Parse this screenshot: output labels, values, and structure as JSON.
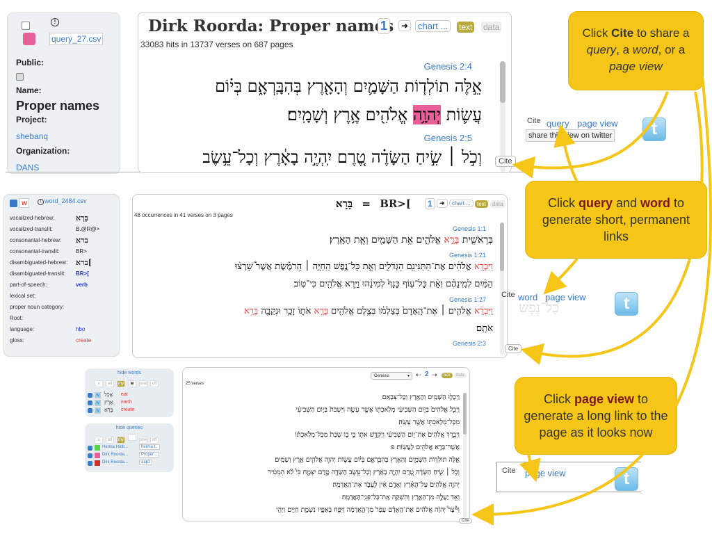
{
  "p1": {
    "csv": "query_27.csv",
    "public_label": "Public:",
    "name_label": "Name:",
    "name_value": "Proper names",
    "project_label": "Project:",
    "project_value": "shebanq",
    "org_label": "Organization:",
    "org_value": "DANS",
    "title": "Dirk Roorda: Proper names",
    "page_num": "1",
    "arrow": "➜",
    "chart_btn": "chart ...",
    "text_btn": "text",
    "data_btn": "data",
    "hits": "33083 hits in 13737 verses on 687 pages",
    "ref1": "Genesis 2:4",
    "line1": "אֵ֣לֶּה תוֹלְד֧וֹת הַשָּׁמַ֛יִם וְהָאָ֖רֶץ בְּהִבָּֽרְאָ֑ם בְּי֗וֹם",
    "line2a": "עֲשׂ֛וֹת ",
    "line2b": "יְהוָ֥ה",
    "line2c": " אֱלֹהִ֖ים אֶ֥רֶץ וְשָׁמָֽיִם׃",
    "ref2": "Genesis 2:5",
    "line3": "וְכֹ֣ל ׀ שִׂ֣יחַ הַשָּׂדֶ֗ה טֶ֚רֶם יִֽהְיֶ֣ה בָאָ֔רֶץ וְכָל־עֵ֥שֶׂב",
    "cite": "Cite",
    "cite_query": "query",
    "cite_page": "page view",
    "tooltip": "share this view on twitter"
  },
  "p2": {
    "csv": "word_2484.csv",
    "features": [
      {
        "k": "vocalized-hebrew:",
        "v": "בָּרָא"
      },
      {
        "k": "vocalized-translit:",
        "v": "B.@R@>"
      },
      {
        "k": "consonantal-hebrew:",
        "v": "ברא"
      },
      {
        "k": "consonantal-translit:",
        "v": "BR>"
      },
      {
        "k": "disambiguated-hebrew:",
        "v": "ברא["
      },
      {
        "k": "disambiguated-translit:",
        "v": "BR>["
      },
      {
        "k": "part-of-speech:",
        "v": "verb"
      },
      {
        "k": "lexical set:",
        "v": ""
      },
      {
        "k": "proper noun category:",
        "v": ""
      },
      {
        "k": "Root:",
        "v": ""
      },
      {
        "k": "language:",
        "v": "hbo"
      },
      {
        "k": "gloss:",
        "v": "create"
      }
    ],
    "title_heb": "בָּרָא",
    "title_eq": "=",
    "title_translit": "BR>[",
    "page_num": "1",
    "chart_btn": "chart ...",
    "text_btn": "text",
    "data_btn": "data",
    "hits": "48 occurrences in 41 verses on 3 pages",
    "ref1": "Genesis 1:1",
    "v1a": "בְּרֵאשִׁ֖ית ",
    "v1b": "בָּרָ֣א",
    "v1c": " אֱלֹהִ֑ים אֵ֥ת הַשָּׁמַ֖יִם וְאֵ֥ת הָאָֽרֶץ׃",
    "ref2": "Genesis 1:21",
    "v2a": "וַיִּבְרָ֣א",
    "v2b": " אֱלֹהִ֔ים אֶת־הַתַּנִּינִ֖ם הַגְּדֹלִ֑ים וְאֵ֣ת כָּל־נֶ֣פֶשׁ הַֽחַיָּ֣ה ׀ הָֽרֹמֶ֡שֶׂת אֲשֶׁר֩ שָׁרְצ֨וּ",
    "v2c": "הַמַּ֜יִם לְמִֽינֵהֶ֗ם וְאֵ֨ת כָּל־ע֤וֹף כָּנָף֙ לְמִינֵ֔הוּ וַיַּ֥רְא אֱלֹהִ֖ים כִּי־טֽוֹב׃",
    "ref3": "Genesis 1:27",
    "v3a": "וַיִּבְרָ֨א",
    "v3b": " אֱלֹהִ֤ים ׀ אֶת־הָֽאָדָם֙ בְּצַלְמ֔וֹ בְּצֶ֥לֶם אֱלֹהִ֖ים ",
    "v3c": "בָּרָ֣א",
    "v3d": " אֹת֑וֹ זָכָ֥ר וּנְקֵבָ֖ה ",
    "v3e": "בָּרָ֥א",
    "v3f": "אֹתָֽם׃",
    "ref4": "Genesis 2:3",
    "cite": "Cite",
    "cite_word": "word",
    "cite_page": "page view",
    "ghost": "כָּל־נֶפֶשׁ"
  },
  "p3": {
    "hide_words": "hide words",
    "filters": [
      "x",
      "all",
      "my",
      "w",
      "one",
      "off"
    ],
    "words": [
      {
        "heb": "אָכַל",
        "gloss": "eat",
        "color": "#8fd3f4"
      },
      {
        "heb": "אֶרֶץ",
        "gloss": "earth",
        "color": "#8fd3f4"
      },
      {
        "heb": "בָּרָא",
        "gloss": "create",
        "color": "#8fd3f4"
      }
    ],
    "hide_queries": "hide queries",
    "qfilters": [
      "x",
      "all",
      "my",
      "",
      "one",
      "off"
    ],
    "queries": [
      {
        "name": "Herma Holtr...",
        "q": "herma t..",
        "color": "#55d24a"
      },
      {
        "name": "Dirk Roorda...",
        "q": "Proper ..",
        "color": "#e8609a"
      },
      {
        "name": "Dirk Roorda...",
        "q": "aap2",
        "color": "#c73030"
      }
    ],
    "book": "Genesis",
    "page_num": "2",
    "text_btn": "text",
    "data_btn": "data",
    "verses_count": "25 verses",
    "lines": [
      "וַיְכֻלּ֛וּ הַשָּׁמַ֥יִם וְהָאָ֖רֶץ וְכָל־צְבָאָֽם׃",
      "וַיְכַ֤ל אֱלֹהִים֙ בַּיּ֣וֹם הַשְּׁבִיעִ֔י מְלַאכְתּ֖וֹ אֲשֶׁ֣ר עָשָׂ֑ה וַיִּשְׁבֹּת֙ בַּיּ֣וֹם הַשְּׁבִיעִ֔י",
      "מִכָּל־מְלַאכְתּ֖וֹ אֲשֶׁ֥ר עָשָֽׂה׃",
      "וַיְבָ֤רֶךְ אֱלֹהִים֙ אֶת־י֣וֹם הַשְּׁבִיעִ֔י וַיְקַדֵּ֖שׁ אֹת֑וֹ כִּ֣י ב֤וֹ שָׁבַת֙ מִכָּל־מְלַאכְתּ֔וֹ",
      "אֲשֶׁר־בָּרָ֥א אֱלֹהִ֖ים לַעֲשֽׂוֹת׃ פ",
      "אֵ֣לֶּה תוֹלְד֧וֹת הַשָּׁמַ֛יִם וְהָאָ֖רֶץ בְּהִבָּֽרְאָ֑ם בְּי֗וֹם עֲשׂ֛וֹת יְהוָ֥ה אֱלֹהִ֖ים אֶ֥רֶץ וְשָׁמָֽיִם׃",
      "וְכֹ֣ל ׀ שִׂ֣יחַ הַשָּׂדֶ֗ה טֶ֚רֶם יִֽהְיֶ֣ה בָאָ֔רֶץ וְכָל־עֵ֥שֶׂב הַשָּׂדֶ֖ה טֶ֣רֶם יִצְמָ֑ח כִּי֩ לֹ֨א הִמְטִ֜יר",
      "יְהוָ֤ה אֱלֹהִים֙ עַל־הָאָ֔רֶץ וְאָדָ֣ם אַ֔יִן לַֽעֲבֹ֖ד אֶת־הָֽאֲדָמָֽה׃",
      "וְאֵ֖ד יַעֲלֶ֣ה מִן־הָאָ֑רֶץ וְהִשְׁקָ֖ה אֶֽת־כָּל־פְּנֵֽי־הָאֲדָמָֽה׃",
      "וַיִּ֩יצֶר֩ יְהוָ֨ה אֱלֹהִ֜ים אֶת־הָֽאָדָ֗ם עָפָר֙ מִן־הָ֣אֲדָמָ֔ה וַיִּפַּ֥ח בְּאַפָּ֖יו נִשְׁמַ֣ת חַיִּ֑ים וַיְהִ֥י"
    ],
    "cite": "Cite",
    "cite_page": "page view"
  },
  "callouts": {
    "c1_pre": "Click ",
    "c1_bold": "Cite",
    "c1_mid": " to share a ",
    "c1_query": "query",
    "c1_comma": ", a ",
    "c1_word": "word",
    "c1_or": ", or a",
    "c1_page": "page view",
    "c2_pre": "Click ",
    "c2_query": "query",
    "c2_and": " and ",
    "c2_word": "word",
    "c2_rest": " to generate short, permanent links",
    "c3_pre": "Click ",
    "c3_bold": "page view",
    "c3_rest": " to generate a long link to the page as it looks now"
  },
  "colors": {
    "callout": "#f5c518",
    "link": "#3a7bc8",
    "highlight": "#e8609a"
  }
}
